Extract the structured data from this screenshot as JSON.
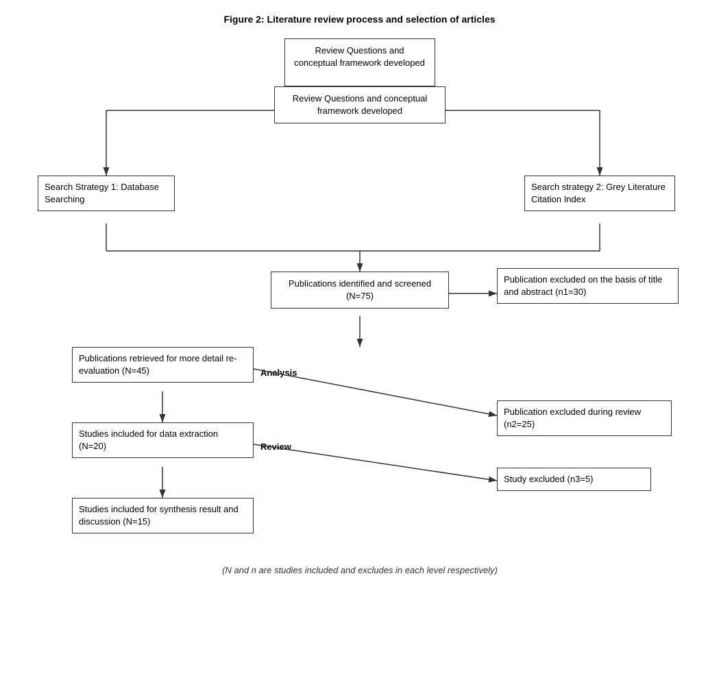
{
  "figure": {
    "title": "Figure 2: Literature review process and selection of articles",
    "top_box": "Review Questions and conceptual framework developed",
    "left_box": "Search Strategy 1: Database Searching",
    "right_box": "Search strategy 2: Grey Literature Citation Index",
    "publications_box": "Publications identified and screened (N=75)",
    "excluded_title_box": "Publication excluded on the basis of title and abstract (n1=30)",
    "retrieved_box": "Publications retrieved for more detail re-evaluation (N=45)",
    "label_analysis": "Analysis",
    "excluded_review_box": "Publication excluded during review (n2=25)",
    "label_review": "Review",
    "studies_extraction_box": "Studies included for data extraction (N=20)",
    "excluded_study_box": "Study excluded (n3=5)",
    "studies_synthesis_box": "Studies included for synthesis result and discussion (N=15)",
    "footer": "(N and n are studies included and excludes in each level respectively)"
  }
}
